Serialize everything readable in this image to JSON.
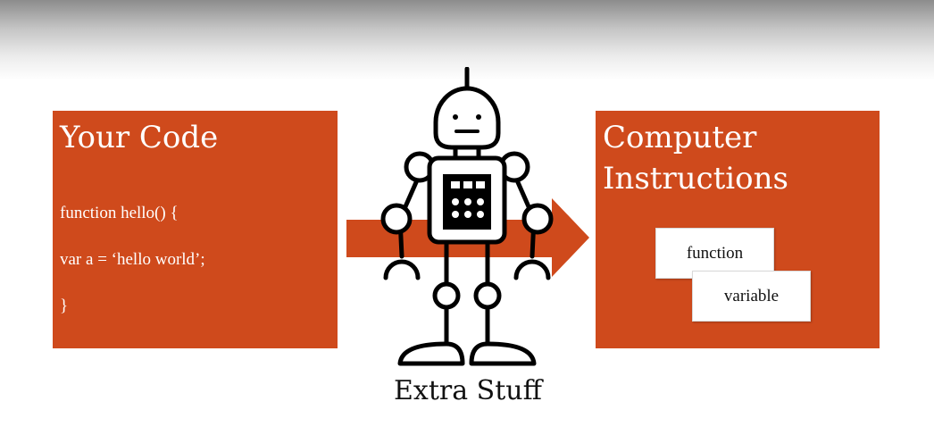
{
  "left_panel": {
    "title": "Your Code",
    "code_lines": [
      "function hello() {",
      "var a = ‘hello world’;",
      "}"
    ]
  },
  "right_panel": {
    "title_line1": "Computer",
    "title_line2": "Instructions",
    "boxes": [
      "function",
      "variable"
    ]
  },
  "robot": {
    "label": "Extra Stuff"
  },
  "colors": {
    "accent": "#cf4a1c",
    "text_light": "#ffffff",
    "text_dark": "#111111"
  },
  "icons": {
    "arrow": "right-arrow-icon",
    "robot": "robot-icon"
  }
}
